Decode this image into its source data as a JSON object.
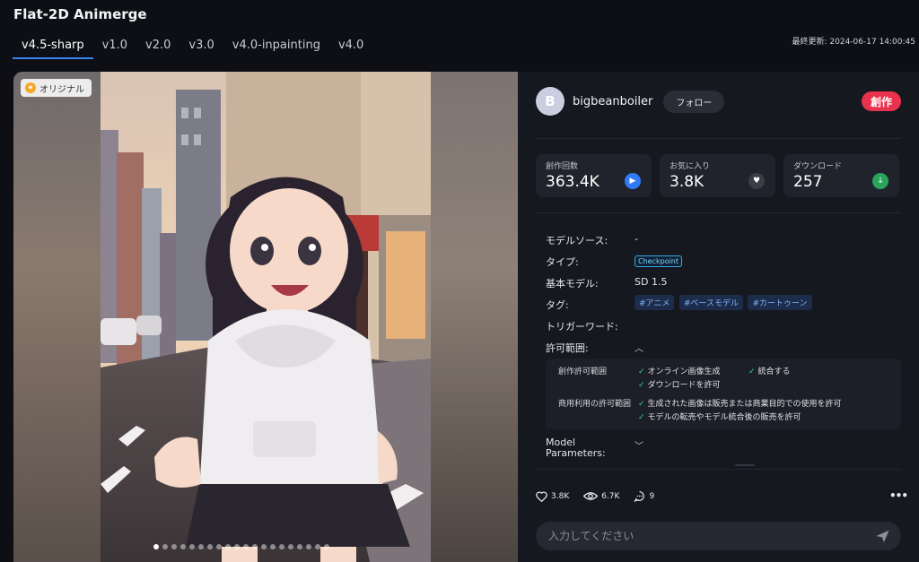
{
  "header": {
    "title": "Flat-2D Animerge",
    "tabs": [
      "v4.5-sharp",
      "v1.0",
      "v2.0",
      "v3.0",
      "v4.0-inpainting",
      "v4.0"
    ],
    "active_tab": 0,
    "updated_label": "最終更新:",
    "updated_date": "2024-06-17 14:00:45"
  },
  "gallery": {
    "badge": "オリジナル",
    "dots_total": 20,
    "dots_active": 0
  },
  "author": {
    "avatar_letter": "B",
    "name": "bigbeanboiler",
    "follow": "フォロー",
    "create": "創作"
  },
  "stats": [
    {
      "label": "創作回数",
      "value": "363.4K",
      "icon": "play-icon",
      "color": "#2f7bf6"
    },
    {
      "label": "お気に入り",
      "value": "3.8K",
      "icon": "heart-icon",
      "color": "#3a3d46"
    },
    {
      "label": "ダウンロード",
      "value": "257",
      "icon": "download-icon",
      "color": "#2aa35c"
    }
  ],
  "meta": {
    "source_label": "モデルソース:",
    "source_value": "-",
    "type_label": "タイプ:",
    "type_value": "Checkpoint",
    "base_label": "基本モデル:",
    "base_value": "SD 1.5",
    "tags_label": "タグ:",
    "tags": [
      "#アニメ",
      "#ベースモデル",
      "#カートゥーン"
    ],
    "trigger_label": "トリガーワード:",
    "permission_label": "許可範囲:",
    "params_label_1": "Model",
    "params_label_2": "Parameters:"
  },
  "permissions": {
    "create_label": "創作許可範囲",
    "create_items": [
      "オンライン画像生成",
      "統合する",
      "ダウンロードを許可"
    ],
    "commercial_label": "商用利用の許可範囲",
    "commercial_items": [
      "生成された画像は販売または商業目的での使用を許可",
      "モデルの転売やモデル統合後の販売を許可"
    ]
  },
  "actions": {
    "likes": "3.8K",
    "views": "6.7K",
    "comments": "9"
  },
  "comment": {
    "placeholder": "入力してください"
  },
  "colors": {
    "accent": "#3b82f6",
    "create": "#e9334e",
    "check": "#3fd283"
  }
}
